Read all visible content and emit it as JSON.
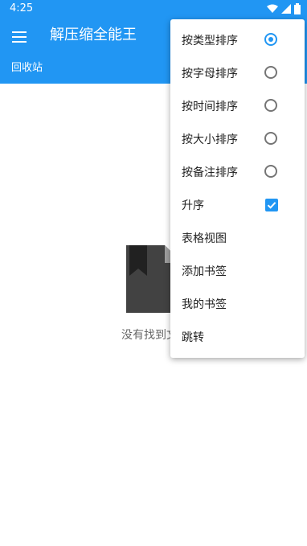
{
  "status": {
    "time": "4:25"
  },
  "app": {
    "title": "解压缩全能王",
    "subtitle": "回收站",
    "accent": "#2196f3"
  },
  "empty": {
    "text": "没有找到文"
  },
  "menu": {
    "items": [
      {
        "label": "按类型排序",
        "control": "radio",
        "checked": true
      },
      {
        "label": "按字母排序",
        "control": "radio",
        "checked": false
      },
      {
        "label": "按时间排序",
        "control": "radio",
        "checked": false
      },
      {
        "label": "按大小排序",
        "control": "radio",
        "checked": false
      },
      {
        "label": "按备注排序",
        "control": "radio",
        "checked": false
      },
      {
        "label": "升序",
        "control": "checkbox",
        "checked": true
      },
      {
        "label": "表格视图",
        "control": "none"
      },
      {
        "label": "添加书签",
        "control": "none"
      },
      {
        "label": "我的书签",
        "control": "none"
      },
      {
        "label": "跳转",
        "control": "none"
      }
    ]
  }
}
